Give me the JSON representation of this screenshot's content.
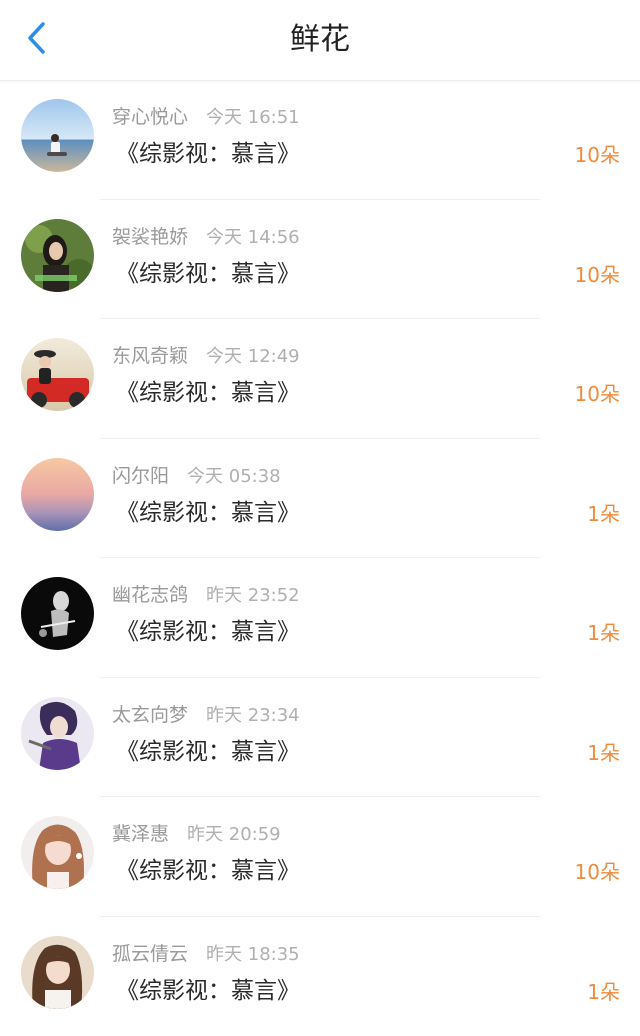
{
  "header": {
    "title": "鲜花",
    "accent": "#2b8ee8"
  },
  "items": [
    {
      "name": "穿心悦心",
      "time": "今天 16:51",
      "book": "《综影视：慕言》",
      "amount": "10朵"
    },
    {
      "name": "袈裟艳娇",
      "time": "今天 14:56",
      "book": "《综影视：慕言》",
      "amount": "10朵"
    },
    {
      "name": "东风奇颖",
      "time": "今天 12:49",
      "book": "《综影视：慕言》",
      "amount": "10朵"
    },
    {
      "name": "闪尔阳",
      "time": "今天 05:38",
      "book": "《综影视：慕言》",
      "amount": "1朵"
    },
    {
      "name": "幽花志鸽",
      "time": "昨天 23:52",
      "book": "《综影视：慕言》",
      "amount": "1朵"
    },
    {
      "name": "太玄向梦",
      "time": "昨天 23:34",
      "book": "《综影视：慕言》",
      "amount": "1朵"
    },
    {
      "name": "冀泽惠",
      "time": "昨天 20:59",
      "book": "《综影视：慕言》",
      "amount": "10朵"
    },
    {
      "name": "孤云倩云",
      "time": "昨天 18:35",
      "book": "《综影视：慕言》",
      "amount": "1朵"
    }
  ],
  "colors": {
    "amount": "#f08a3c",
    "name": "#9a9a9a",
    "title": "#222222"
  }
}
